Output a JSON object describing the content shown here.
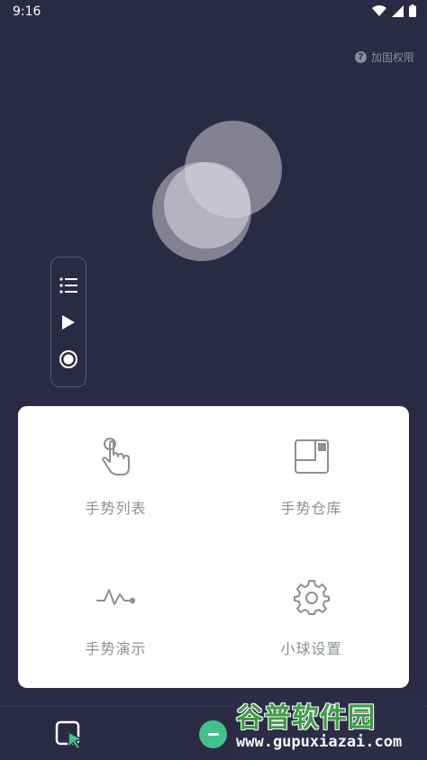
{
  "status": {
    "time": "9:16",
    "icons": [
      "wifi-icon",
      "signal-icon",
      "battery-icon"
    ]
  },
  "header": {
    "perm_label": "加固权限",
    "perm_icon": "help-icon"
  },
  "float_bar": {
    "buttons": [
      "list-icon",
      "play-icon",
      "record-icon"
    ]
  },
  "menu": {
    "items": [
      {
        "label": "手势列表",
        "icon": "tap-gesture-icon"
      },
      {
        "label": "手势仓库",
        "icon": "warehouse-icon"
      },
      {
        "label": "手势演示",
        "icon": "pulse-line-icon"
      },
      {
        "label": "小球设置",
        "icon": "gear-icon"
      }
    ]
  },
  "bottom_bar": {
    "left_icon": "select-cursor-icon",
    "center_icon": "minus-icon"
  },
  "watermark": {
    "title": "谷普软件园",
    "url": "www.gupuxiazai.com"
  },
  "colors": {
    "background": "#2a2a42",
    "accent": "#43c08a",
    "icon_gray": "#8a9294"
  }
}
